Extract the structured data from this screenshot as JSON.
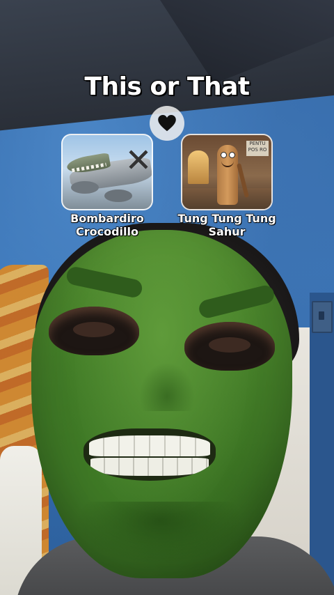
{
  "filter": {
    "title": "This or That",
    "center_icon": "heart-icon",
    "options": [
      {
        "label_line1": "Bombardiro",
        "label_line2": "Crocodillo",
        "thumbnail": "bombardiro-crocodillo-image"
      },
      {
        "label_line1": "Tung Tung Tung",
        "label_line2": "Sahur",
        "thumbnail": "tung-tung-tung-sahur-image"
      }
    ],
    "thumbnail_sign_text": "PENTU POS RO"
  },
  "colors": {
    "title_text": "#ffffff",
    "text_outline": "#000000",
    "heart": "#111111",
    "heart_badge_bg": "#f0f0f0",
    "wall_blue": "#3a74b6",
    "mask_green": "#4f8a2e"
  }
}
